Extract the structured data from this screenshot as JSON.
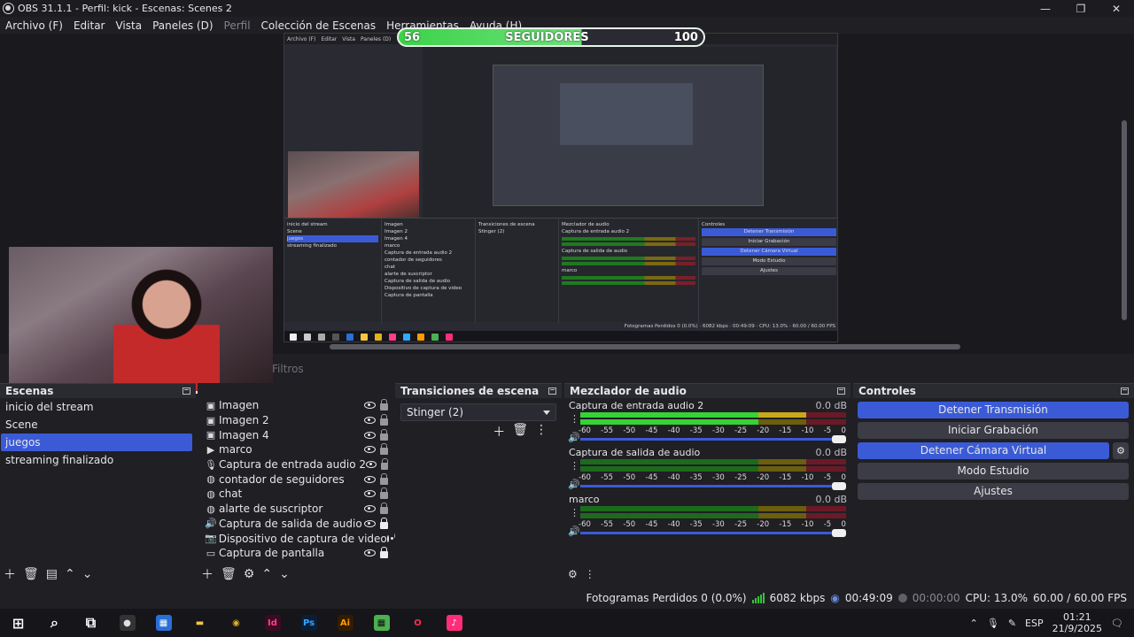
{
  "window": {
    "title": "OBS 31.1.1 - Perfil: kick - Escenas: Scenes 2",
    "min": "—",
    "max": "❐",
    "close": "✕"
  },
  "menu": [
    {
      "label": "Archivo (F)",
      "disabled": false
    },
    {
      "label": "Editar",
      "disabled": false
    },
    {
      "label": "Vista",
      "disabled": false
    },
    {
      "label": "Paneles (D)",
      "disabled": false
    },
    {
      "label": "Perfil",
      "disabled": true
    },
    {
      "label": "Colección de Escenas",
      "disabled": false
    },
    {
      "label": "Herramientas",
      "disabled": false
    },
    {
      "label": "Ayuda (H)",
      "disabled": false
    }
  ],
  "overlay": {
    "left": "56",
    "center": "SEGUIDORES",
    "right": "100"
  },
  "filters_tab": "Filtros",
  "scenes": {
    "header": "Escenas",
    "items": [
      "inicio del stream",
      "Scene",
      "juegos",
      "streaming finalizado"
    ],
    "selected": 2,
    "footer_icons": [
      "add-icon",
      "trash-icon",
      "filter-icon",
      "arrow-up-icon",
      "arrow-down-icon"
    ]
  },
  "sources": {
    "items": [
      {
        "name": "Imagen",
        "icon": "image-icon",
        "glyph": "▣",
        "locked": false
      },
      {
        "name": "Imagen 2",
        "icon": "image-icon",
        "glyph": "▣",
        "locked": false
      },
      {
        "name": "Imagen 4",
        "icon": "image-icon",
        "glyph": "▣",
        "locked": false
      },
      {
        "name": "marco",
        "icon": "play-icon",
        "glyph": "▶",
        "locked": false
      },
      {
        "name": "Captura de entrada audio 2",
        "icon": "microphone-icon",
        "glyph": "🎙",
        "locked": false
      },
      {
        "name": "contador de seguidores",
        "icon": "globe-icon",
        "glyph": "◍",
        "locked": false
      },
      {
        "name": "chat",
        "icon": "globe-icon",
        "glyph": "◍",
        "locked": false
      },
      {
        "name": "alarte de suscriptor",
        "icon": "globe-icon",
        "glyph": "◍",
        "locked": false
      },
      {
        "name": "Captura de salida de audio",
        "icon": "speaker-icon",
        "glyph": "🔊",
        "locked": true
      },
      {
        "name": "Dispositivo de captura de video",
        "icon": "camera-icon",
        "glyph": "📷",
        "locked": false
      },
      {
        "name": "Captura de pantalla",
        "icon": "monitor-icon",
        "glyph": "▭",
        "locked": true
      }
    ]
  },
  "transitions": {
    "header": "Transiciones de escena",
    "selected": "Stinger (2)"
  },
  "mixer": {
    "header": "Mezclador de audio",
    "ticks": [
      "-60",
      "-55",
      "-50",
      "-45",
      "-40",
      "-35",
      "-30",
      "-25",
      "-20",
      "-15",
      "-10",
      "-5",
      "0"
    ],
    "channels": [
      {
        "name": "Captura de entrada audio 2",
        "db": "0.0 dB",
        "level": 0.67,
        "peak": 0.85
      },
      {
        "name": "Captura de salida de audio",
        "db": "0.0 dB",
        "level": 0,
        "peak": 0
      },
      {
        "name": "marco",
        "db": "0.0 dB",
        "level": 0,
        "peak": 0
      }
    ]
  },
  "controls": {
    "header": "Controles",
    "buttons": [
      {
        "label": "Detener Transmisión",
        "active": true
      },
      {
        "label": "Iniciar Grabación",
        "active": false
      },
      {
        "label": "Detener Cámara Virtual",
        "active": true
      },
      {
        "label": "Modo Estudio",
        "active": false
      },
      {
        "label": "Ajustes",
        "active": false
      }
    ]
  },
  "status": {
    "dropped": "Fotogramas Perdidos 0 (0.0%)",
    "bitrate": "6082 kbps",
    "stream_time": "00:49:09",
    "rec_time": "00:00:00",
    "cpu": "CPU: 13.0%",
    "fps": "60.00 / 60.00 FPS"
  },
  "taskbar": {
    "apps": [
      {
        "name": "windows-start-icon",
        "glyph": "⊞",
        "color": "#ffffff",
        "bg": "transparent"
      },
      {
        "name": "search-icon",
        "glyph": "⌕",
        "color": "#ffffff",
        "bg": "transparent"
      },
      {
        "name": "task-view-icon",
        "glyph": "⧉",
        "color": "#ffffff",
        "bg": "transparent"
      },
      {
        "name": "obs-icon",
        "glyph": "●",
        "color": "#e0e0e0",
        "bg": "#333"
      },
      {
        "name": "store-icon",
        "glyph": "▦",
        "color": "#ffffff",
        "bg": "#2a6fd6"
      },
      {
        "name": "folder-icon",
        "glyph": "▬",
        "color": "#f5c542",
        "bg": "transparent"
      },
      {
        "name": "chrome-icon",
        "glyph": "◉",
        "color": "#e2b21e",
        "bg": "transparent"
      },
      {
        "name": "indesign-icon",
        "glyph": "Id",
        "color": "#ff3d8b",
        "bg": "#3a0b22"
      },
      {
        "name": "photoshop-icon",
        "glyph": "Ps",
        "color": "#31a8ff",
        "bg": "#0b1e36"
      },
      {
        "name": "illustrator-icon",
        "glyph": "Ai",
        "color": "#ff9a00",
        "bg": "#331b00"
      },
      {
        "name": "minecraft-icon",
        "glyph": "▦",
        "color": "#111",
        "bg": "#4caf50"
      },
      {
        "name": "opera-gx-icon",
        "glyph": "O",
        "color": "#ff2d55",
        "bg": "transparent"
      },
      {
        "name": "tiktok-icon",
        "glyph": "♪",
        "color": "#ffffff",
        "bg": "#ff2d7a"
      }
    ],
    "lang": "ESP",
    "time": "01:21",
    "date": "21/9/2025"
  },
  "colors": {
    "accent": "#3b5bd6",
    "meter_green": "#36d236"
  }
}
